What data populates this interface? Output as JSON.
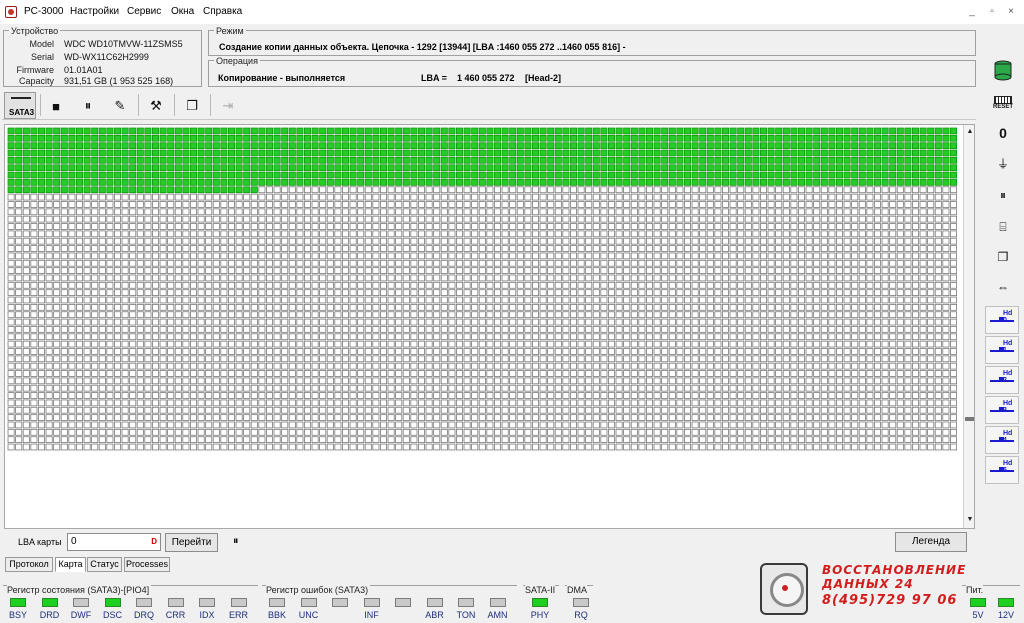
{
  "app": {
    "title": "PC-3000"
  },
  "menu": [
    "Настройки",
    "Сервис",
    "Окна",
    "Справка"
  ],
  "window_controls": [
    "_",
    "▫",
    "×"
  ],
  "device": {
    "group_title": "Устройство",
    "model_label": "Model",
    "model": "WDC WD10TMVW-11ZSMS5",
    "serial_label": "Serial",
    "serial": "WD-WX11C62H2999",
    "firmware_label": "Firmware",
    "firmware": "01.01A01",
    "capacity_label": "Capacity",
    "capacity": "931,51 GB (1 953 525 168)"
  },
  "mode": {
    "group_title": "Режим",
    "text": "Создание копии данных объекта. Цепочка - 1292 [13944] [LBA :1460 055 272 ..1460 055 816] -"
  },
  "operation": {
    "group_title": "Операция",
    "status": "Копирование - выполняется",
    "lba_label": "LBA =",
    "lba_value": "1 460 055 272",
    "head": "[Head-2]"
  },
  "toolbar": {
    "sata_label": "SATA3",
    "buttons": [
      {
        "name": "stop",
        "icon": "■"
      },
      {
        "name": "pause",
        "icon": "⏸"
      },
      {
        "name": "task",
        "icon": "✎"
      },
      {
        "name": "tools",
        "icon": "⚒"
      },
      {
        "name": "windows",
        "icon": "❐"
      },
      {
        "name": "exit",
        "icon": "⇥"
      }
    ]
  },
  "map": {
    "total_cells": 5500,
    "completed_cells": 1033,
    "done_color": "#25cc25",
    "pending_color": "#ffffff"
  },
  "map_controls": {
    "lba_label": "LBA карты",
    "lba_value": "0",
    "go_button": "Перейти",
    "pause_icon": "⏸",
    "legend_button": "Легенда"
  },
  "tabs": [
    {
      "label": "Протокол",
      "active": false
    },
    {
      "label": "Карта",
      "active": true
    },
    {
      "label": "Статус",
      "active": false
    },
    {
      "label": "Processes",
      "active": false
    }
  ],
  "status_register": {
    "title": "Регистр состояния (SATA3)-[PIO4]",
    "leds": [
      {
        "label": "BSY",
        "on": true
      },
      {
        "label": "DRD",
        "on": true
      },
      {
        "label": "DWF",
        "on": false
      },
      {
        "label": "DSC",
        "on": true
      },
      {
        "label": "DRQ",
        "on": false
      },
      {
        "label": "CRR",
        "on": false
      },
      {
        "label": "IDX",
        "on": false
      },
      {
        "label": "ERR",
        "on": false
      }
    ]
  },
  "error_register": {
    "title": "Регистр ошибок (SATA3)",
    "leds": [
      {
        "label": "BBK",
        "on": false
      },
      {
        "label": "UNC",
        "on": false
      },
      {
        "label": "",
        "on": false
      },
      {
        "label": "INF",
        "on": false
      },
      {
        "label": "",
        "on": false
      },
      {
        "label": "ABR",
        "on": false
      },
      {
        "label": "TON",
        "on": false
      },
      {
        "label": "AMN",
        "on": false
      }
    ]
  },
  "sata2": {
    "title": "SATA-II",
    "label": "PHY",
    "on": true
  },
  "dma": {
    "title": "DMA",
    "label": "RQ",
    "on": false
  },
  "power": {
    "title": "Пит.",
    "leds": [
      {
        "label": "5V",
        "on": true
      },
      {
        "label": "12V",
        "on": true
      }
    ]
  },
  "right_toolbar": {
    "reset_label": "RESET",
    "heads": [
      "Hd 0",
      "Hd 1",
      "Hd 2",
      "Hd 3",
      "Hd 4",
      "Hd 5"
    ]
  },
  "logo": {
    "line1": "ВОССТАНОВЛЕНИЕ",
    "line2": "ДАННЫХ 24",
    "line3": "8(495)729 97 06"
  }
}
